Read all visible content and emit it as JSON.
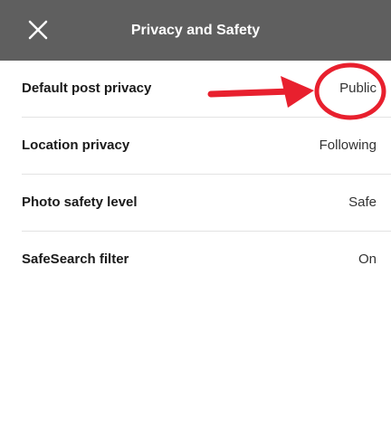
{
  "header": {
    "title": "Privacy and Safety",
    "close_icon": "close-icon"
  },
  "settings": [
    {
      "label": "Default post privacy",
      "value": "Public"
    },
    {
      "label": "Location privacy",
      "value": "Following"
    },
    {
      "label": "Photo safety level",
      "value": "Safe"
    },
    {
      "label": "SafeSearch filter",
      "value": "On"
    }
  ],
  "colors": {
    "header_bg": "#5f5f5f",
    "annotation": "#e8202e"
  }
}
